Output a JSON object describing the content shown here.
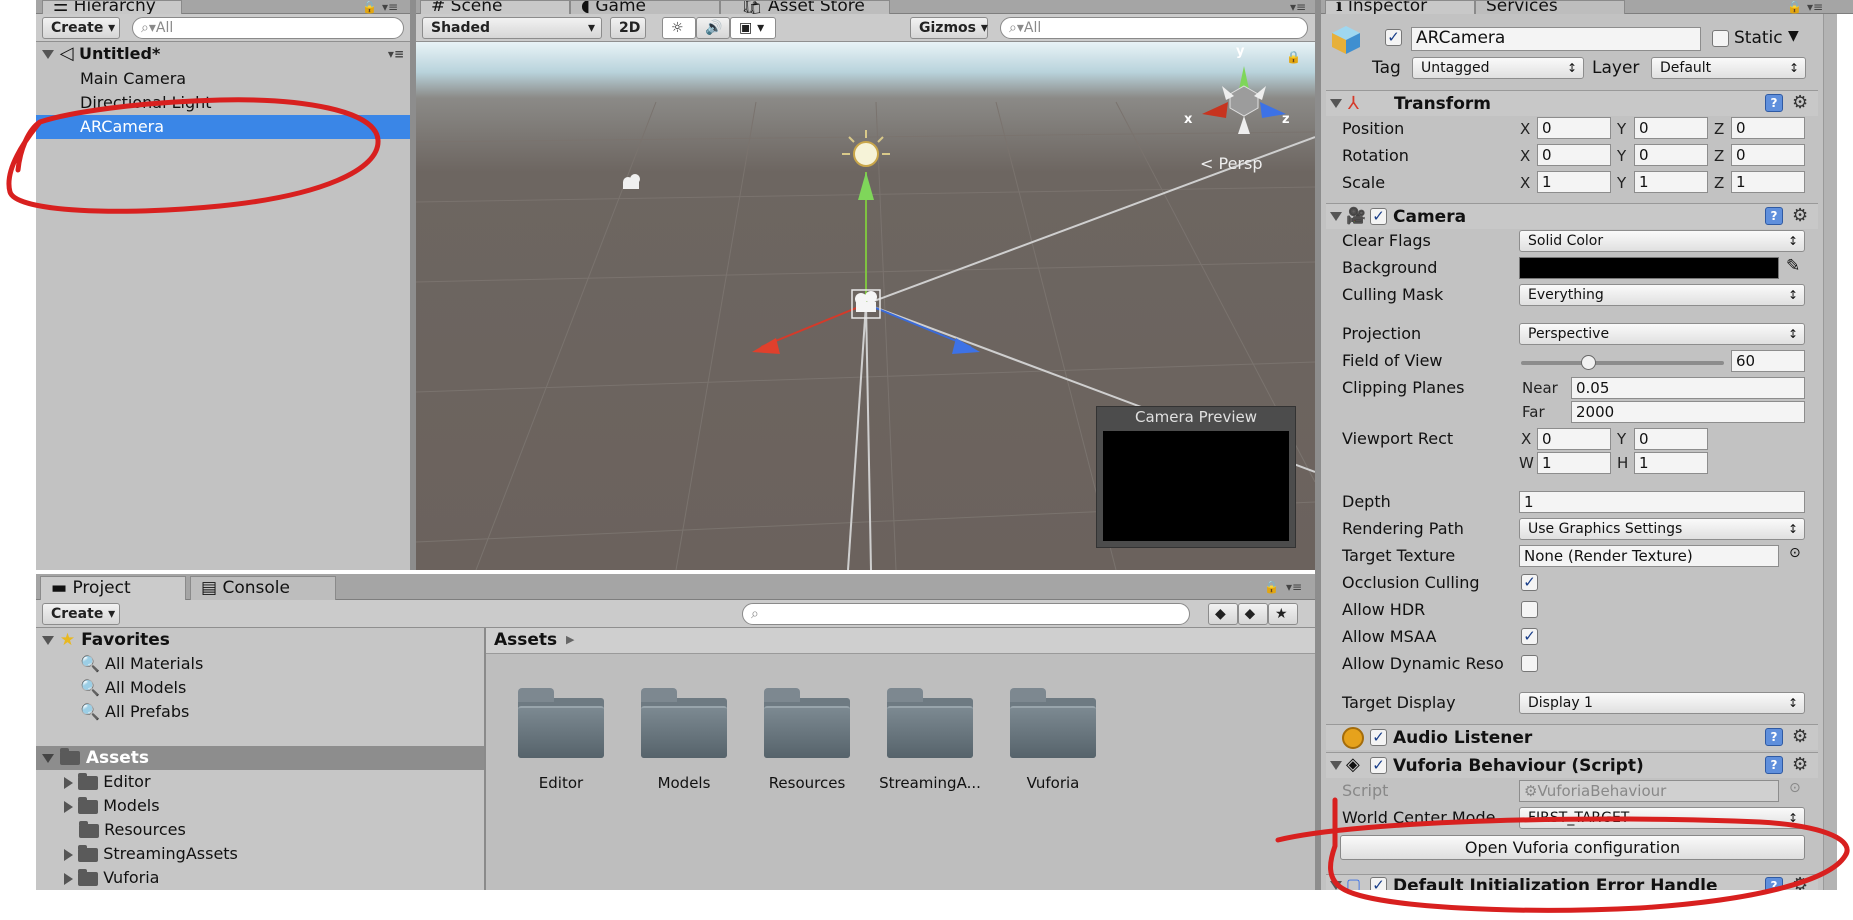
{
  "hierarchy": {
    "tab_label": "Hierarchy",
    "create_label": "Create",
    "search_placeholder": "All",
    "scene_name": "Untitled*",
    "items": [
      "Main Camera",
      "Directional Light",
      "ARCamera"
    ]
  },
  "scene": {
    "tabs": [
      "Scene",
      "Game",
      "Asset Store"
    ],
    "shading_mode": "Shaded",
    "mode_2d_label": "2D",
    "gizmos_label": "Gizmos",
    "search_placeholder": "All",
    "persp_label": "Persp",
    "axis_x": "x",
    "axis_y": "y",
    "axis_z": "z",
    "camera_preview_title": "Camera Preview"
  },
  "project": {
    "tabs": [
      "Project",
      "Console"
    ],
    "create_label": "Create",
    "favorites_label": "Favorites",
    "favorites": [
      "All Materials",
      "All Models",
      "All Prefabs"
    ],
    "assets_label": "Assets",
    "asset_tree": [
      "Editor",
      "Models",
      "Resources",
      "StreamingAssets",
      "Vuforia"
    ],
    "breadcrumb": "Assets",
    "grid_items": [
      "Editor",
      "Models",
      "Resources",
      "StreamingA...",
      "Vuforia"
    ]
  },
  "inspector": {
    "tabs": [
      "Inspector",
      "Services"
    ],
    "object_name": "ARCamera",
    "static_label": "Static",
    "tag_label": "Tag",
    "tag_value": "Untagged",
    "layer_label": "Layer",
    "layer_value": "Default",
    "transform": {
      "title": "Transform",
      "rows": [
        {
          "label": "Position",
          "x": "0",
          "y": "0",
          "z": "0"
        },
        {
          "label": "Rotation",
          "x": "0",
          "y": "0",
          "z": "0"
        },
        {
          "label": "Scale",
          "x": "1",
          "y": "1",
          "z": "1"
        }
      ]
    },
    "camera": {
      "title": "Camera",
      "clear_flags_label": "Clear Flags",
      "clear_flags_value": "Solid Color",
      "background_label": "Background",
      "background_color": "#000000",
      "culling_mask_label": "Culling Mask",
      "culling_mask_value": "Everything",
      "projection_label": "Projection",
      "projection_value": "Perspective",
      "fov_label": "Field of View",
      "fov_value": "60",
      "clipping_label": "Clipping Planes",
      "near_label": "Near",
      "near_value": "0.05",
      "far_label": "Far",
      "far_value": "2000",
      "viewport_label": "Viewport Rect",
      "viewport": {
        "x": "0",
        "y": "0",
        "w": "1",
        "h": "1"
      },
      "depth_label": "Depth",
      "depth_value": "1",
      "rendering_path_label": "Rendering Path",
      "rendering_path_value": "Use Graphics Settings",
      "target_texture_label": "Target Texture",
      "target_texture_value": "None (Render Texture)",
      "occlusion_label": "Occlusion Culling",
      "allow_hdr_label": "Allow HDR",
      "allow_msaa_label": "Allow MSAA",
      "allow_dynamic_label": "Allow Dynamic Reso",
      "target_display_label": "Target Display",
      "target_display_value": "Display 1"
    },
    "audio_listener_title": "Audio Listener",
    "vuforia": {
      "title": "Vuforia Behaviour (Script)",
      "script_label": "Script",
      "script_value": "VuforiaBehaviour",
      "world_center_label": "World Center Mode",
      "world_center_value": "FIRST_TARGET",
      "open_config_label": "Open Vuforia configuration"
    },
    "next_component_title": "Default Initialization Error Handle"
  },
  "annotation_color": "#d8201f",
  "selection_color": "#3a86e7"
}
